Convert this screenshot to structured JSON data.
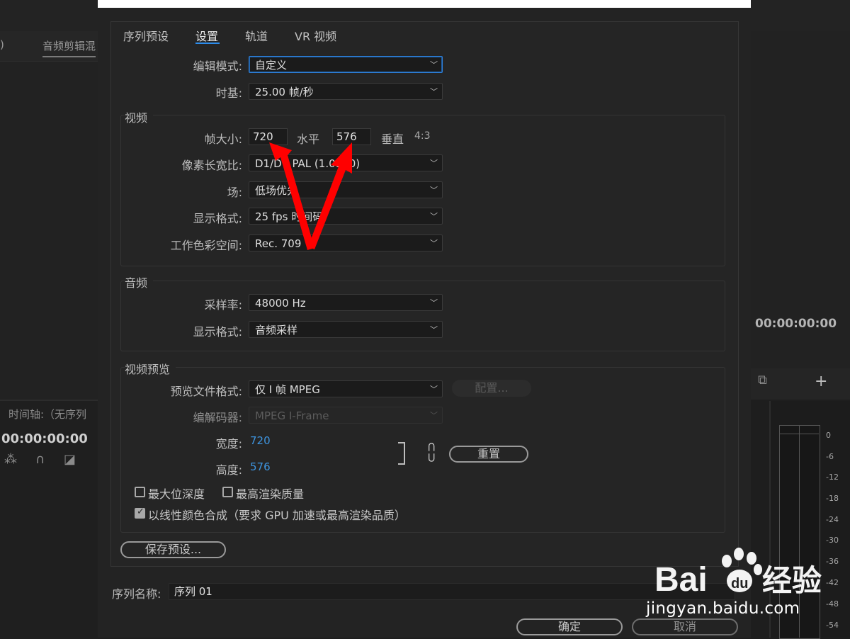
{
  "background": {
    "left_paren": ")",
    "audio_tab": "音频剪辑混",
    "timeline_title": "时间轴:（无序列",
    "timecode_left": "00:00:00:00",
    "timecode_right": "00:00:00:00",
    "meter_labels": [
      "0",
      "-6",
      "-12",
      "-18",
      "-24",
      "-30",
      "-36",
      "-42",
      "-48",
      "-54"
    ]
  },
  "dialog": {
    "tabs": [
      "序列预设",
      "设置",
      "轨道",
      "VR 视频"
    ],
    "active_tab": "设置",
    "edit_mode": {
      "label": "编辑模式:",
      "value": "自定义"
    },
    "timebase": {
      "label": "时基:",
      "value": "25.00  帧/秒"
    },
    "video": {
      "title": "视频",
      "frame_size_label": "帧大小:",
      "width": "720",
      "horizontal_label": "水平",
      "height": "576",
      "vertical_label": "垂直",
      "aspect": "4:3",
      "pixel_aspect": {
        "label": "像素长宽比:",
        "value": "D1/DV PAL (1.0940)"
      },
      "fields": {
        "label": "场:",
        "value": "低场优先"
      },
      "display_format": {
        "label": "显示格式:",
        "value": "25 fps 时间码"
      },
      "color_space": {
        "label": "工作色彩空间:",
        "value": "Rec. 709"
      }
    },
    "audio": {
      "title": "音频",
      "sample_rate": {
        "label": "采样率:",
        "value": "48000 Hz"
      },
      "display_format": {
        "label": "显示格式:",
        "value": "音频采样"
      }
    },
    "preview": {
      "title": "视频预览",
      "file_format": {
        "label": "预览文件格式:",
        "value": "仅 I 帧 MPEG"
      },
      "configure": "配置...",
      "codec": {
        "label": "编解码器:",
        "value": "MPEG I-Frame"
      },
      "width_label": "宽度:",
      "width_value": "720",
      "height_label": "高度:",
      "height_value": "576",
      "reset": "重置",
      "max_bit_depth": "最大位深度",
      "max_render_quality": "最高渲染质量",
      "linear_color": "以线性颜色合成（要求 GPU 加速或最高渲染品质）",
      "max_bit_depth_checked": false,
      "max_render_quality_checked": false,
      "linear_color_checked": true
    },
    "save_preset": "保存预设...",
    "sequence_name": {
      "label": "序列名称:",
      "value": "序列 01"
    },
    "ok": "确定",
    "cancel": "取消"
  },
  "watermark": {
    "text": "jingyan.baidu.com"
  },
  "colors": {
    "accent": "#2d8ceb",
    "annotation_arrow": "#ff0000"
  }
}
